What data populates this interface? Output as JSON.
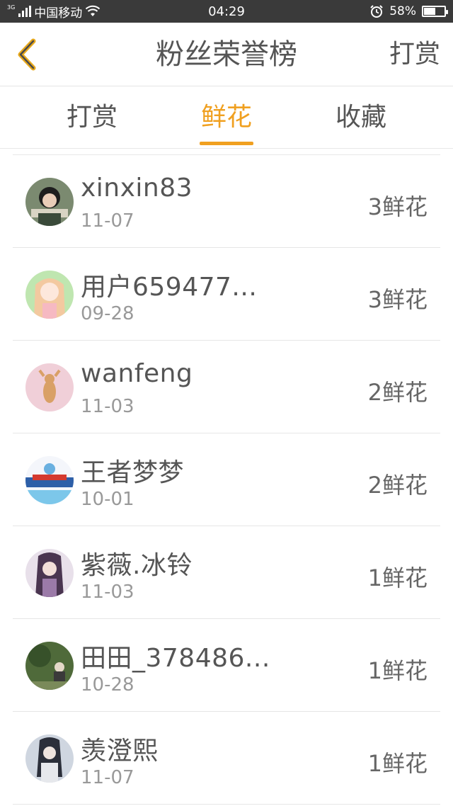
{
  "status_bar": {
    "network_gen": "3G",
    "carrier": "中国移动",
    "time": "04:29",
    "battery_percent_label": "58%",
    "battery_level": 0.58,
    "icons": [
      "signal-icon",
      "wifi-icon",
      "alarm-icon",
      "battery-icon"
    ]
  },
  "header": {
    "back_icon": "chevron-left-icon",
    "title": "粉丝荣誉榜",
    "action_label": "打赏",
    "accent_color": "#f0a020"
  },
  "tabs": [
    {
      "label": "打赏",
      "active": false
    },
    {
      "label": "鲜花",
      "active": true
    },
    {
      "label": "收藏",
      "active": false
    }
  ],
  "fans": [
    {
      "name": "xinxin83",
      "date": "11-07",
      "count": "3鲜花"
    },
    {
      "name": "用户659477...",
      "date": "09-28",
      "count": "3鲜花"
    },
    {
      "name": "wanfeng",
      "date": "11-03",
      "count": "2鲜花"
    },
    {
      "name": "王者梦梦",
      "date": "10-01",
      "count": "2鲜花"
    },
    {
      "name": "紫薇.冰铃",
      "date": "11-03",
      "count": "1鲜花"
    },
    {
      "name": "田田_378486...",
      "date": "10-28",
      "count": "1鲜花"
    },
    {
      "name": "羡澄熙",
      "date": "11-07",
      "count": "1鲜花"
    }
  ]
}
